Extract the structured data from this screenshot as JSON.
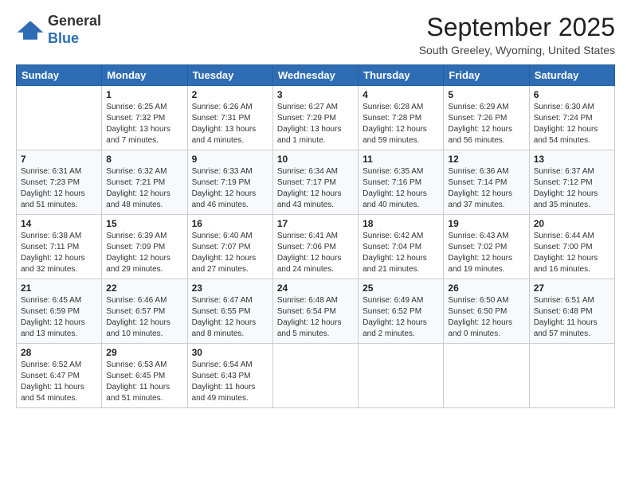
{
  "header": {
    "logo": {
      "general": "General",
      "blue": "Blue"
    },
    "month": "September 2025",
    "location": "South Greeley, Wyoming, United States"
  },
  "weekdays": [
    "Sunday",
    "Monday",
    "Tuesday",
    "Wednesday",
    "Thursday",
    "Friday",
    "Saturday"
  ],
  "weeks": [
    [
      {
        "day": "",
        "info": ""
      },
      {
        "day": "1",
        "info": "Sunrise: 6:25 AM\nSunset: 7:32 PM\nDaylight: 13 hours\nand 7 minutes."
      },
      {
        "day": "2",
        "info": "Sunrise: 6:26 AM\nSunset: 7:31 PM\nDaylight: 13 hours\nand 4 minutes."
      },
      {
        "day": "3",
        "info": "Sunrise: 6:27 AM\nSunset: 7:29 PM\nDaylight: 13 hours\nand 1 minute."
      },
      {
        "day": "4",
        "info": "Sunrise: 6:28 AM\nSunset: 7:28 PM\nDaylight: 12 hours\nand 59 minutes."
      },
      {
        "day": "5",
        "info": "Sunrise: 6:29 AM\nSunset: 7:26 PM\nDaylight: 12 hours\nand 56 minutes."
      },
      {
        "day": "6",
        "info": "Sunrise: 6:30 AM\nSunset: 7:24 PM\nDaylight: 12 hours\nand 54 minutes."
      }
    ],
    [
      {
        "day": "7",
        "info": "Sunrise: 6:31 AM\nSunset: 7:23 PM\nDaylight: 12 hours\nand 51 minutes."
      },
      {
        "day": "8",
        "info": "Sunrise: 6:32 AM\nSunset: 7:21 PM\nDaylight: 12 hours\nand 48 minutes."
      },
      {
        "day": "9",
        "info": "Sunrise: 6:33 AM\nSunset: 7:19 PM\nDaylight: 12 hours\nand 46 minutes."
      },
      {
        "day": "10",
        "info": "Sunrise: 6:34 AM\nSunset: 7:17 PM\nDaylight: 12 hours\nand 43 minutes."
      },
      {
        "day": "11",
        "info": "Sunrise: 6:35 AM\nSunset: 7:16 PM\nDaylight: 12 hours\nand 40 minutes."
      },
      {
        "day": "12",
        "info": "Sunrise: 6:36 AM\nSunset: 7:14 PM\nDaylight: 12 hours\nand 37 minutes."
      },
      {
        "day": "13",
        "info": "Sunrise: 6:37 AM\nSunset: 7:12 PM\nDaylight: 12 hours\nand 35 minutes."
      }
    ],
    [
      {
        "day": "14",
        "info": "Sunrise: 6:38 AM\nSunset: 7:11 PM\nDaylight: 12 hours\nand 32 minutes."
      },
      {
        "day": "15",
        "info": "Sunrise: 6:39 AM\nSunset: 7:09 PM\nDaylight: 12 hours\nand 29 minutes."
      },
      {
        "day": "16",
        "info": "Sunrise: 6:40 AM\nSunset: 7:07 PM\nDaylight: 12 hours\nand 27 minutes."
      },
      {
        "day": "17",
        "info": "Sunrise: 6:41 AM\nSunset: 7:06 PM\nDaylight: 12 hours\nand 24 minutes."
      },
      {
        "day": "18",
        "info": "Sunrise: 6:42 AM\nSunset: 7:04 PM\nDaylight: 12 hours\nand 21 minutes."
      },
      {
        "day": "19",
        "info": "Sunrise: 6:43 AM\nSunset: 7:02 PM\nDaylight: 12 hours\nand 19 minutes."
      },
      {
        "day": "20",
        "info": "Sunrise: 6:44 AM\nSunset: 7:00 PM\nDaylight: 12 hours\nand 16 minutes."
      }
    ],
    [
      {
        "day": "21",
        "info": "Sunrise: 6:45 AM\nSunset: 6:59 PM\nDaylight: 12 hours\nand 13 minutes."
      },
      {
        "day": "22",
        "info": "Sunrise: 6:46 AM\nSunset: 6:57 PM\nDaylight: 12 hours\nand 10 minutes."
      },
      {
        "day": "23",
        "info": "Sunrise: 6:47 AM\nSunset: 6:55 PM\nDaylight: 12 hours\nand 8 minutes."
      },
      {
        "day": "24",
        "info": "Sunrise: 6:48 AM\nSunset: 6:54 PM\nDaylight: 12 hours\nand 5 minutes."
      },
      {
        "day": "25",
        "info": "Sunrise: 6:49 AM\nSunset: 6:52 PM\nDaylight: 12 hours\nand 2 minutes."
      },
      {
        "day": "26",
        "info": "Sunrise: 6:50 AM\nSunset: 6:50 PM\nDaylight: 12 hours\nand 0 minutes."
      },
      {
        "day": "27",
        "info": "Sunrise: 6:51 AM\nSunset: 6:48 PM\nDaylight: 11 hours\nand 57 minutes."
      }
    ],
    [
      {
        "day": "28",
        "info": "Sunrise: 6:52 AM\nSunset: 6:47 PM\nDaylight: 11 hours\nand 54 minutes."
      },
      {
        "day": "29",
        "info": "Sunrise: 6:53 AM\nSunset: 6:45 PM\nDaylight: 11 hours\nand 51 minutes."
      },
      {
        "day": "30",
        "info": "Sunrise: 6:54 AM\nSunset: 6:43 PM\nDaylight: 11 hours\nand 49 minutes."
      },
      {
        "day": "",
        "info": ""
      },
      {
        "day": "",
        "info": ""
      },
      {
        "day": "",
        "info": ""
      },
      {
        "day": "",
        "info": ""
      }
    ]
  ]
}
